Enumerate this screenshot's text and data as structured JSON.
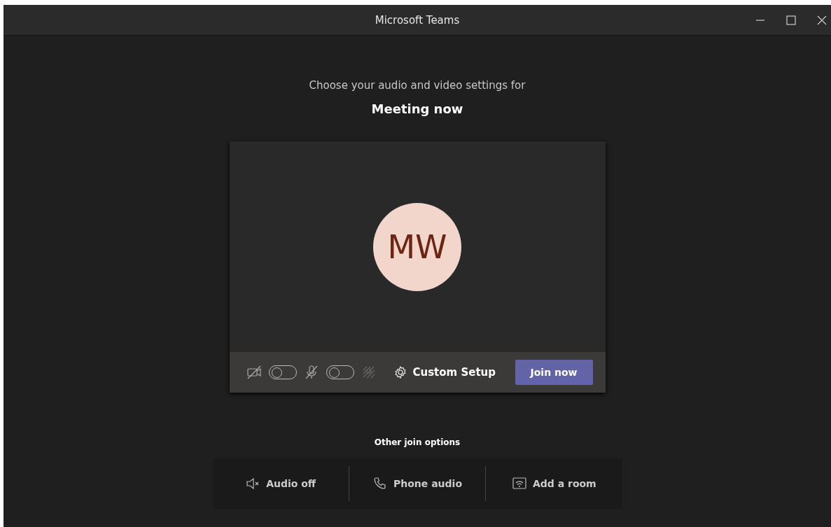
{
  "window": {
    "title": "Microsoft Teams"
  },
  "prompt": "Choose your audio and video settings for",
  "meeting_title": "Meeting now",
  "preview": {
    "initials": "MW"
  },
  "toolbar": {
    "controls": [
      {
        "kind": "camera",
        "on": false
      },
      {
        "kind": "microphone",
        "on": false
      },
      {
        "kind": "effects",
        "disabled": true
      }
    ],
    "settings_button": "Custom Setup",
    "join_button": "Join now"
  },
  "other_options": {
    "heading": "Other join options",
    "items": [
      {
        "kind": "audio-off",
        "label": "Audio off"
      },
      {
        "kind": "phone",
        "label": "Phone audio"
      },
      {
        "kind": "room",
        "label": "Add a room"
      }
    ]
  }
}
